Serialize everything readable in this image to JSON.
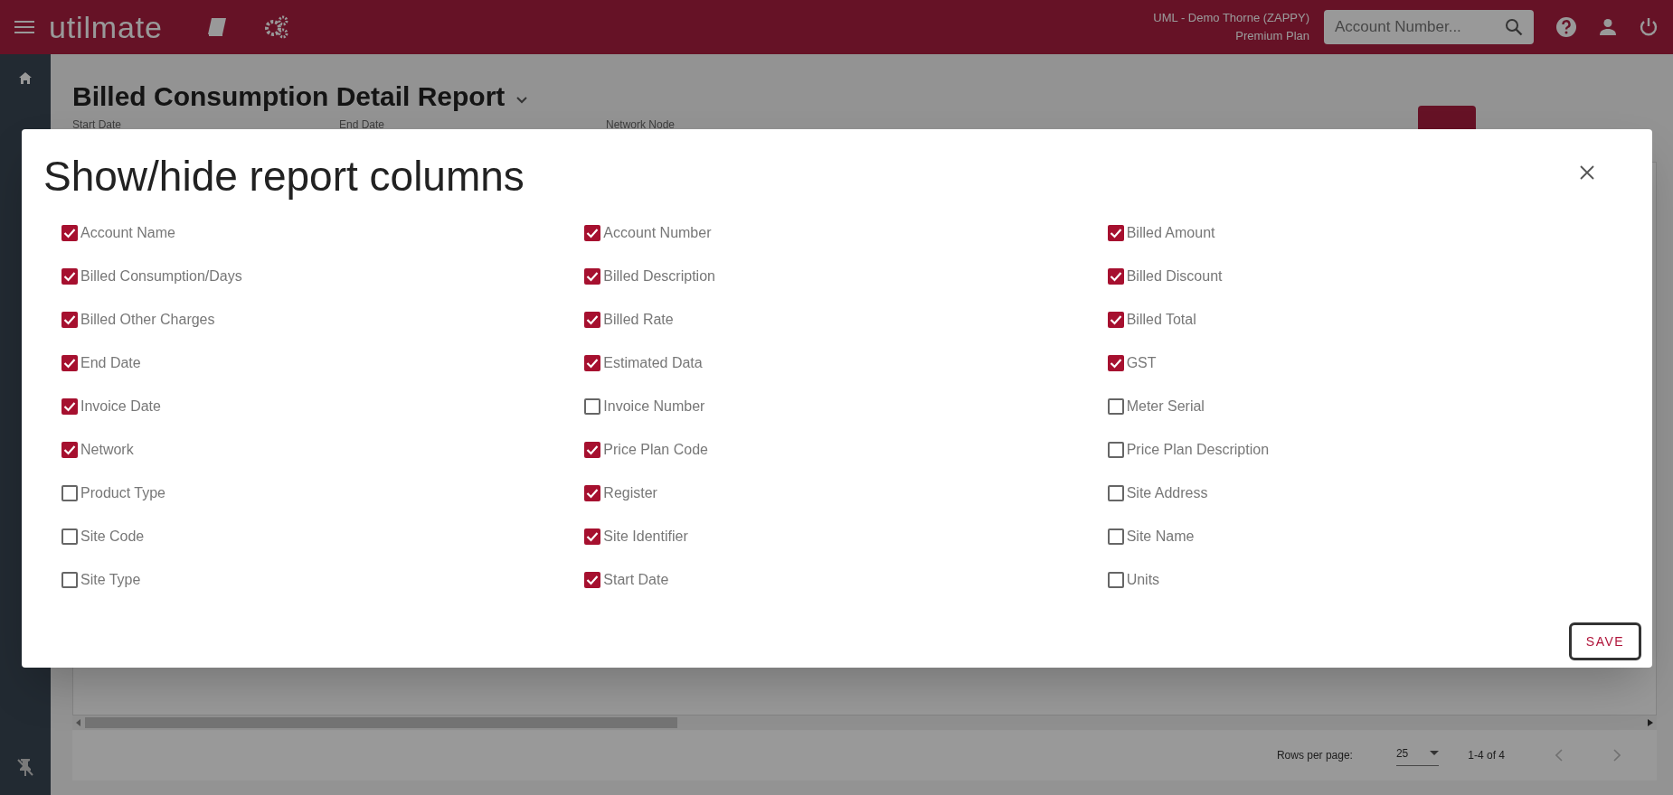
{
  "app_bar": {
    "logo": "utilmate",
    "account": "UML - Demo Thorne (ZAPPY)",
    "plan": "Premium Plan",
    "search": {
      "placeholder": "Account Number..."
    }
  },
  "page": {
    "title": "Billed Consumption Detail Report",
    "filters": [
      "Start Date",
      "End Date",
      "Network Node"
    ],
    "pagination": {
      "rows_per_page_label": "Rows per page:",
      "rows_per_page": "25",
      "range": "1-4 of 4"
    }
  },
  "dialog": {
    "title": "Show/hide report columns",
    "save": "SAVE",
    "columns": [
      {
        "label": "Account Name",
        "checked": true
      },
      {
        "label": "Account Number",
        "checked": true
      },
      {
        "label": "Billed Amount",
        "checked": true
      },
      {
        "label": "Billed Consumption/Days",
        "checked": true
      },
      {
        "label": "Billed Description",
        "checked": true
      },
      {
        "label": "Billed Discount",
        "checked": true
      },
      {
        "label": "Billed Other Charges",
        "checked": true
      },
      {
        "label": "Billed Rate",
        "checked": true
      },
      {
        "label": "Billed Total",
        "checked": true
      },
      {
        "label": "End Date",
        "checked": true
      },
      {
        "label": "Estimated Data",
        "checked": true
      },
      {
        "label": "GST",
        "checked": true
      },
      {
        "label": "Invoice Date",
        "checked": true
      },
      {
        "label": "Invoice Number",
        "checked": false
      },
      {
        "label": "Meter Serial",
        "checked": false
      },
      {
        "label": "Network",
        "checked": true
      },
      {
        "label": "Price Plan Code",
        "checked": true
      },
      {
        "label": "Price Plan Description",
        "checked": false
      },
      {
        "label": "Product Type",
        "checked": false
      },
      {
        "label": "Register",
        "checked": true
      },
      {
        "label": "Site Address",
        "checked": false
      },
      {
        "label": "Site Code",
        "checked": false
      },
      {
        "label": "Site Identifier",
        "checked": true
      },
      {
        "label": "Site Name",
        "checked": false
      },
      {
        "label": "Site Type",
        "checked": false
      },
      {
        "label": "Start Date",
        "checked": true
      },
      {
        "label": "Units",
        "checked": false
      }
    ]
  }
}
